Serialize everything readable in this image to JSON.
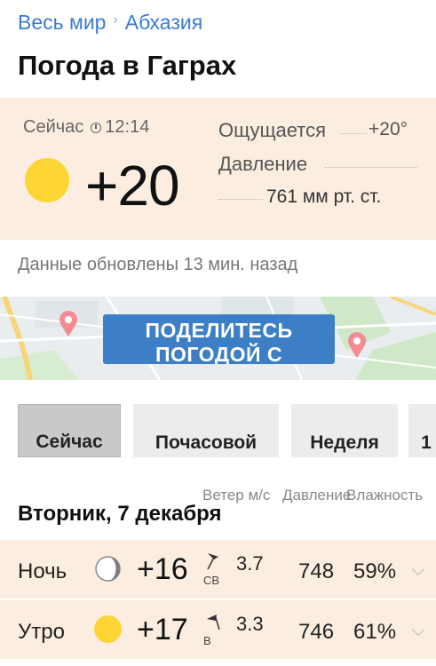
{
  "breadcrumb": {
    "root": "Весь мир",
    "current": "Абхазия"
  },
  "title": "Погода в Гаграх",
  "now": {
    "label": "Сейчас",
    "time": "12:14",
    "temperature": "+20",
    "feels_label": "Ощущается",
    "feels_value": "+20°",
    "pressure_label": "Давление",
    "pressure_value": "761 мм рт. ст."
  },
  "updated": "Данные обновлены 13 мин. назад",
  "map": {
    "share_label": "ПОДЕЛИТЕСЬ ПОГОДОЙ С"
  },
  "tabs": [
    {
      "label": "Сейчас",
      "active": true
    },
    {
      "label": "Почасовой",
      "active": false
    },
    {
      "label": "Неделя",
      "active": false
    },
    {
      "label": "1",
      "active": false
    }
  ],
  "columns": {
    "wind": "Ветер м/с",
    "pressure": "Давление",
    "humidity": "Влажность"
  },
  "day": "Вторник, 7 декабря",
  "rows": [
    {
      "label": "Ночь",
      "icon": "moon-icon",
      "temp": "+16",
      "wind_dir": "СВ",
      "wind_speed": "3.7",
      "pressure": "748",
      "humidity": "59%"
    },
    {
      "label": "Утро",
      "icon": "sun-icon",
      "temp": "+17",
      "wind_dir": "В",
      "wind_speed": "3.3",
      "pressure": "746",
      "humidity": "61%"
    }
  ],
  "colors": {
    "accent": "#3a7bd5",
    "card": "#fbeee0",
    "sun": "#fcd534",
    "button": "#3d7fc6"
  }
}
